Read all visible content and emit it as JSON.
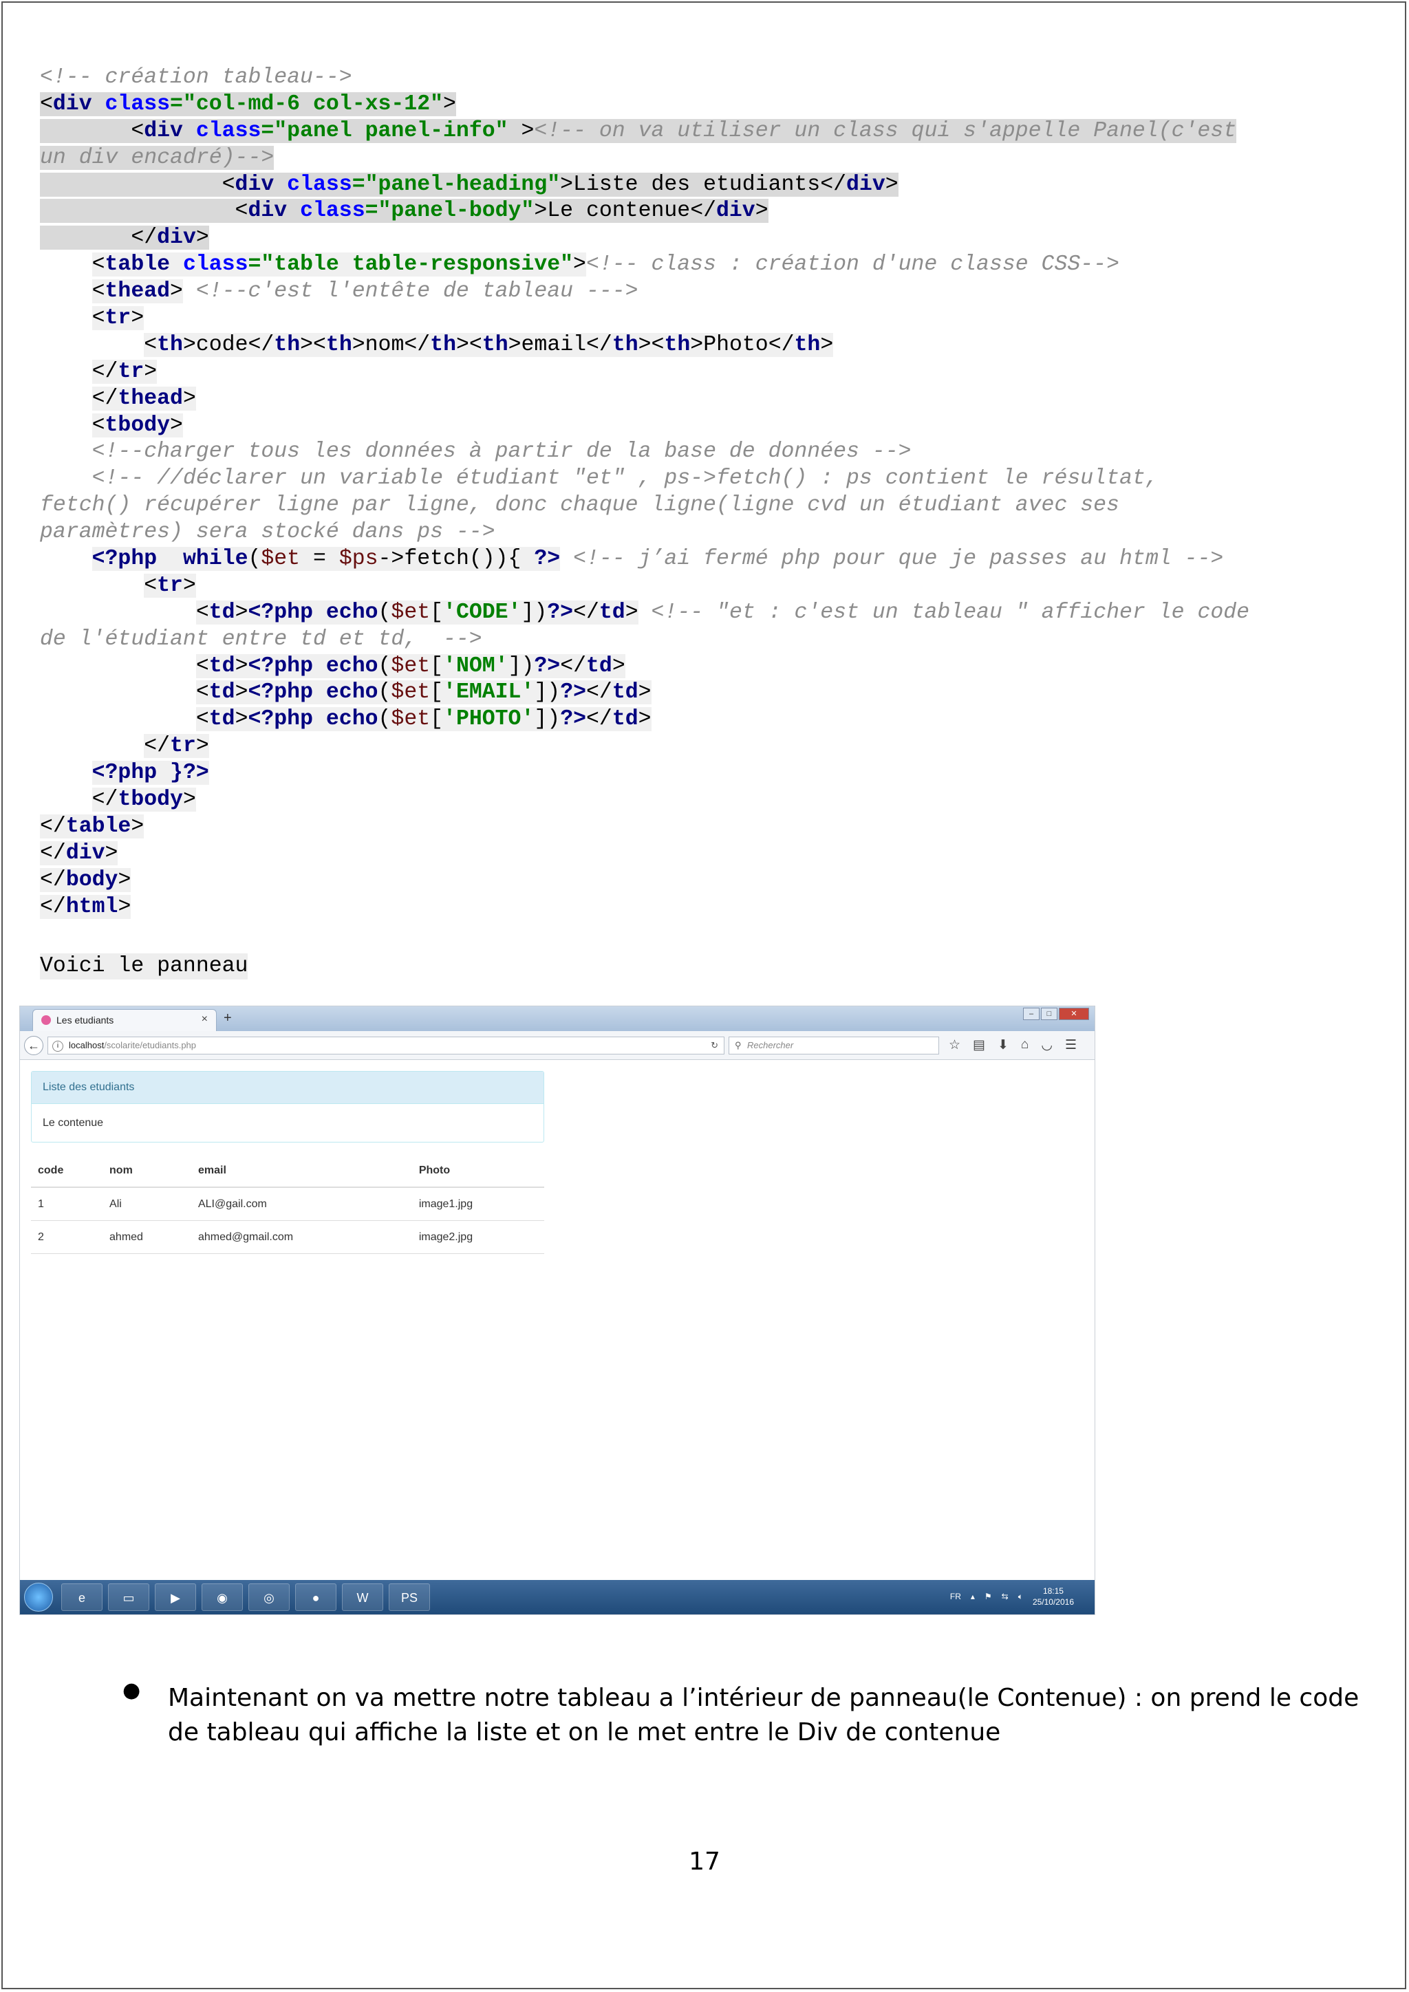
{
  "code": {
    "l1_comment": "<!-- création tableau-->",
    "l2_lt": "<",
    "l2_tag": "div",
    "l2_attr": "class",
    "l2_val": "=\"col-md-6 col-xs-12\"",
    "l2_gt": ">",
    "l3_tag": "div",
    "l3_attr": "class",
    "l3_val": "=\"panel panel-info\"",
    "l3_gt": " >",
    "l3_comment": "<!-- on va utiliser un class qui s'appelle Panel(c'est",
    "l4_comment": "un div encadré)-->",
    "l5_tag": "div",
    "l5_attr": "class",
    "l5_val": "=\"panel-heading\"",
    "l5_text": "Liste des etudiants",
    "l6_tag": "div",
    "l6_attr": "class",
    "l6_val": "=\"panel-body\"",
    "l6_text": "Le contenue",
    "div": "div",
    "l8_tag": "table",
    "l8_attr": "class",
    "l8_val": "=\"table table-responsive\"",
    "l8_comment": "<!-- class : création d'une classe CSS-->",
    "thead": "thead",
    "l9_comment": " <!--c'est l'entête de tableau --->",
    "tr": "tr",
    "th": "th",
    "th1": "code",
    "th2": "nom",
    "th3": "email",
    "th4": "Photo",
    "tbody": "tbody",
    "l15_comment": "<!--charger tous les données à partir de la base de données -->",
    "l16_comment": "<!-- //déclarer un variable étudiant \"et\" , ps->fetch() : ps contient le résultat,",
    "l17_comment": "fetch() récupérer ligne par ligne, donc chaque ligne(ligne cvd un étudiant avec ses",
    "l18_comment": "paramètres) sera stocké dans ps -->",
    "php_open": "<?php",
    "while": "while",
    "et_var": "$et",
    "ps_var": "$ps",
    "fetch_text": "->fetch()){ ",
    "php_close": "?>",
    "l19_comment": " <!-- j’ai fermé php pour que je passes au html -->",
    "td": "td",
    "echo": "echo",
    "key_code": "'CODE'",
    "key_nom": "'NOM'",
    "key_email": "'EMAIL'",
    "key_photo": "'PHOTO'",
    "l21_comment": " <!-- \"et : c'est un tableau \" afficher le code",
    "l22_comment": "de l'étudiant entre td et td,  -->",
    "l27_close": "}?>",
    "table": "table",
    "body": "body",
    "html": "html"
  },
  "voici": "Voici le panneau",
  "browser": {
    "tab_title": "Les etudiants",
    "tab_close": "×",
    "new_tab": "+",
    "url_host": "localhost",
    "url_path": "/scolarite/etudiants.php",
    "search_placeholder": "Rechercher",
    "panel_heading": "Liste des etudiants",
    "panel_body": "Le contenue",
    "table": {
      "headers": [
        "code",
        "nom",
        "email",
        "Photo"
      ],
      "rows": [
        [
          "1",
          "Ali",
          "ALI@gail.com",
          "image1.jpg"
        ],
        [
          "2",
          "ahmed",
          "ahmed@gmail.com",
          "image2.jpg"
        ]
      ]
    },
    "tray_lang": "FR",
    "clock_time": "18:15",
    "clock_date": "25/10/2016"
  },
  "bullet_text": "Maintenant on va mettre notre tableau a l’intérieur de panneau(le Contenue) : on prend le code de tableau qui affiche la liste et on le met entre le Div de contenue",
  "page_number": "17"
}
